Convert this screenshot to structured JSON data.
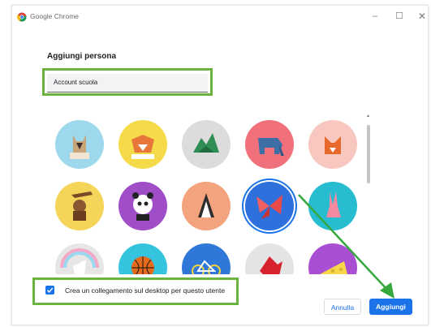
{
  "window": {
    "app_title": "Google Chrome"
  },
  "window_controls": {
    "minimize": "–",
    "maximize": "☐",
    "close": "✕"
  },
  "dialog": {
    "title": "Aggiungi persona",
    "name_value": "Account scuola",
    "shortcut_label": "Crea un collegamento sul desktop per questo utente",
    "shortcut_checked": true,
    "cancel_label": "Annulla",
    "add_label": "Aggiungi"
  },
  "avatars": [
    {
      "icon": "origami-cat",
      "bg": "#9ed8ec"
    },
    {
      "icon": "origami-fox",
      "bg": "#f5da4a"
    },
    {
      "icon": "origami-dragon",
      "bg": "#dcdcdc"
    },
    {
      "icon": "origami-elephant",
      "bg": "#f0707b"
    },
    {
      "icon": "origami-fox-2",
      "bg": "#f8c8c0"
    },
    {
      "icon": "origami-monkey",
      "bg": "#f5d45a"
    },
    {
      "icon": "origami-panda",
      "bg": "#a04ec8"
    },
    {
      "icon": "origami-penguin",
      "bg": "#f3a37e"
    },
    {
      "icon": "origami-butterfly",
      "bg": "#2e70dc",
      "selected": true
    },
    {
      "icon": "origami-rabbit",
      "bg": "#27bccf"
    },
    {
      "icon": "origami-unicorn",
      "bg": "#e6e6e6"
    },
    {
      "icon": "basketball",
      "bg": "#35c4de"
    },
    {
      "icon": "bicycle",
      "bg": "#2f78d8"
    },
    {
      "icon": "origami-bird",
      "bg": "#e4e4e4"
    },
    {
      "icon": "cheese",
      "bg": "#a94fd4"
    }
  ],
  "colors": {
    "accent": "#1a73e8",
    "highlight_box": "#6ab43e",
    "annotation_arrow": "#35a83e"
  }
}
